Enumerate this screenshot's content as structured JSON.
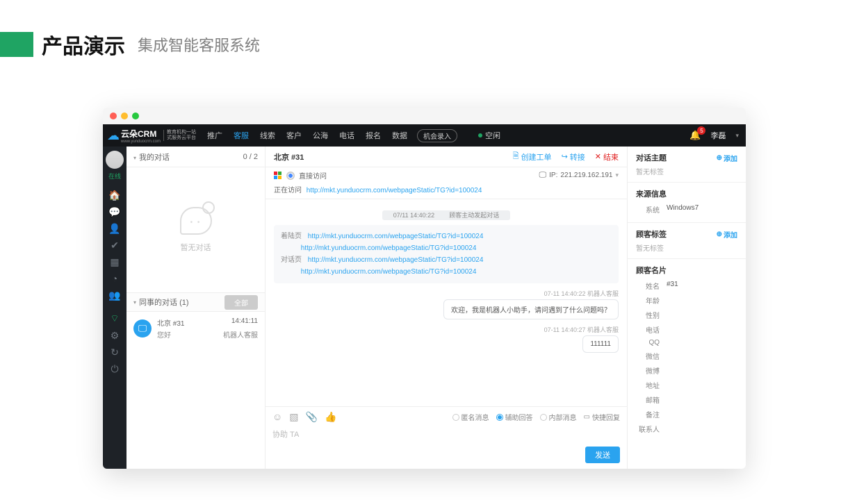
{
  "slide": {
    "title": "产品演示",
    "subtitle": "集成智能客服系统"
  },
  "brand": {
    "name": "云朵CRM",
    "url": "www.yunduocrm.com",
    "tag1": "教育机构一站",
    "tag2": "式服务云平台"
  },
  "nav": {
    "items": [
      "推广",
      "客服",
      "线索",
      "客户",
      "公海",
      "电话",
      "报名",
      "数据"
    ],
    "activeIndex": 1,
    "record": "机会录入",
    "idle": "空闲",
    "bellCount": "5",
    "user": "李磊"
  },
  "iconbar": {
    "online": "在线"
  },
  "conversations": {
    "myHeader": "我的对话",
    "count": "0 / 2",
    "empty": "暂无对话",
    "colleagueHeader": "同事的对话  (1)",
    "segAll": "全部",
    "row": {
      "title": "北京  #31",
      "preview": "您好",
      "time": "14:41:11",
      "agent": "机器人客服"
    }
  },
  "chat": {
    "title": "北京 #31",
    "actions": {
      "ticket": "创建工单",
      "transfer": "转接",
      "end": "结束"
    },
    "directVisit": "直接访问",
    "ipLabel": "IP:",
    "ip": "221.219.162.191",
    "visitingLabel": "正在访问",
    "visitingUrl": "http://mkt.yunduocrm.com/webpageStatic/TG?id=100024",
    "sys1_time": "07/11 14:40:22",
    "sys1_text": "顾客主动发起对话",
    "landingLabel": "着陆页",
    "dialogLabel": "对话页",
    "url1": "http://mkt.yunduocrm.com/webpageStatic/TG?id=100024",
    "url2": "http://mkt.yunduocrm.com/webpageStatic/TG?id=100024",
    "url3": "http://mkt.yunduocrm.com/webpageStatic/TG?id=100024",
    "url4": "http://mkt.yunduocrm.com/webpageStatic/TG?id=100024",
    "m1_meta": "07-11 14:40:22   机器人客服",
    "m1_text": "欢迎，我是机器人小助手，请问遇到了什么问题吗？",
    "m2_meta": "07-11 14:40:27   机器人客服",
    "m2_text": "111111"
  },
  "composer": {
    "anon": "匿名消息",
    "assist": "辅助回答",
    "internal": "内部消息",
    "quick": "快捷回复",
    "placeholder": "协助 TA",
    "send": "发送"
  },
  "right": {
    "topicHeader": "对话主题",
    "add": "添加",
    "noTag": "暂无标签",
    "sourceHeader": "来源信息",
    "sysLabel": "系统",
    "sysVal": "Windows7",
    "tagsHeader": "顾客标签",
    "cardHeader": "顾客名片",
    "fields": {
      "name": "姓名",
      "nameVal": "#31",
      "age": "年龄",
      "gender": "性别",
      "phone": "电话",
      "qq": "QQ",
      "wechat": "微信",
      "weibo": "微博",
      "address": "地址",
      "email": "邮箱",
      "note": "备注",
      "contact": "联系人"
    }
  }
}
